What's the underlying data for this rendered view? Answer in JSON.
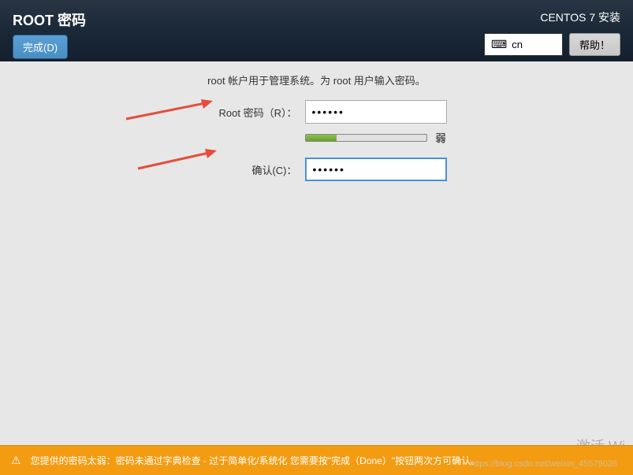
{
  "header": {
    "page_title": "ROOT 密码",
    "done_button": "完成(D)",
    "installer_title": "CENTOS 7 安装",
    "language_code": "cn",
    "help_button": "帮助！"
  },
  "content": {
    "instruction": "root 帐户用于管理系统。为 root 用户输入密码。",
    "password_label": "Root 密码（R）：",
    "password_value": "••••••",
    "confirm_label": "确认(C)：",
    "confirm_value": "••••••",
    "strength_label": "弱",
    "strength_percent": 25
  },
  "warning": {
    "message": "您提供的密码太弱：密码未通过字典检查 - 过于简单化/系统化 您需要按\"完成（Done）\"按钮两次方可确认。"
  },
  "watermark": {
    "text": "激活 Wi",
    "url": "https://blog.csdn.net/weixin_45579026"
  }
}
